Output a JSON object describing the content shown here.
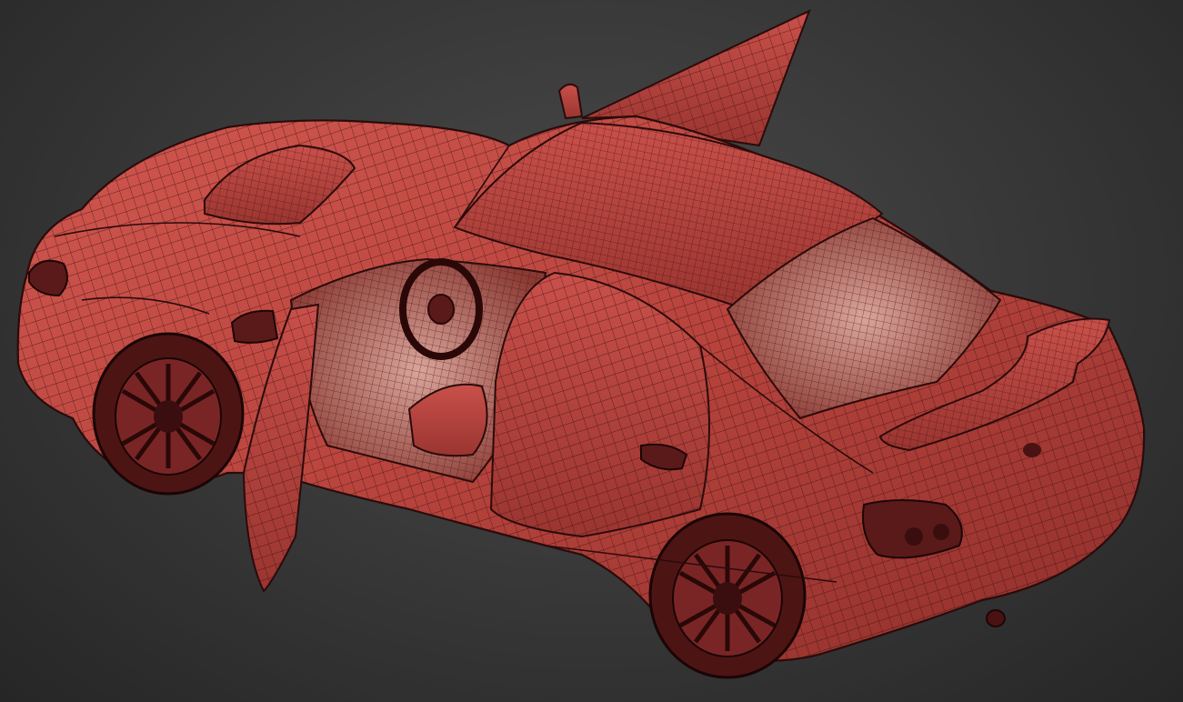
{
  "scene": {
    "subject": "wireframe-car-model",
    "colors": {
      "background_center": "#4a4a4a",
      "background_edge": "#262626",
      "mesh_fill_light": "#d0574f",
      "mesh_fill_dark": "#8f2f2b",
      "wire_line": "#3a0e0e"
    }
  }
}
